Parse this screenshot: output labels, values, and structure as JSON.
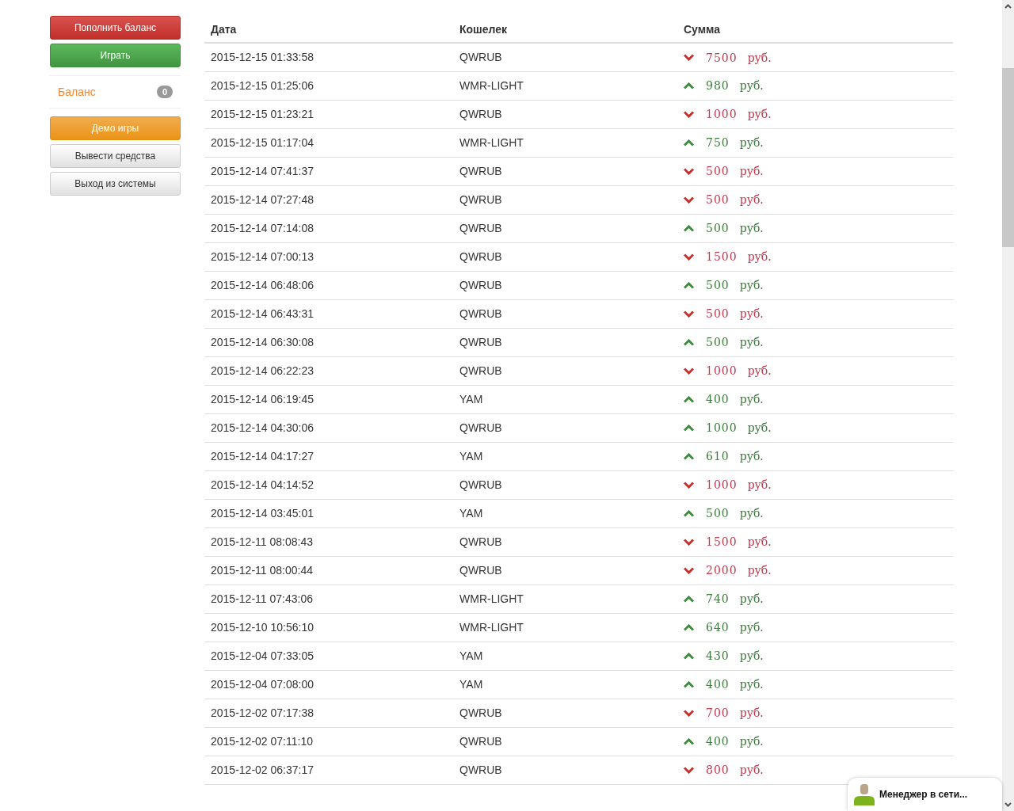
{
  "sidebar": {
    "top_buttons": [
      {
        "label": "Пополнить баланс",
        "kind": "danger"
      },
      {
        "label": "Играть",
        "kind": "success"
      }
    ],
    "balance": {
      "label": "Баланс",
      "badge": "0"
    },
    "bottom_buttons": [
      {
        "label": "Демо игры",
        "kind": "warning"
      },
      {
        "label": "Вывести средства",
        "kind": "default"
      },
      {
        "label": "Выход из системы",
        "kind": "default"
      }
    ]
  },
  "table": {
    "columns": [
      "Дата",
      "Кошелек",
      "Сумма"
    ],
    "rows": [
      {
        "date": "2015-12-15 01:33:58",
        "wallet": "QWRUB",
        "kind": "out",
        "amount": "7500",
        "currency": "руб."
      },
      {
        "date": "2015-12-15 01:25:06",
        "wallet": "WMR-LIGHT",
        "kind": "in",
        "amount": "980",
        "currency": "руб."
      },
      {
        "date": "2015-12-15 01:23:21",
        "wallet": "QWRUB",
        "kind": "out",
        "amount": "1000",
        "currency": "руб."
      },
      {
        "date": "2015-12-15 01:17:04",
        "wallet": "WMR-LIGHT",
        "kind": "in",
        "amount": "750",
        "currency": "руб."
      },
      {
        "date": "2015-12-14 07:41:37",
        "wallet": "QWRUB",
        "kind": "out",
        "amount": "500",
        "currency": "руб."
      },
      {
        "date": "2015-12-14 07:27:48",
        "wallet": "QWRUB",
        "kind": "out",
        "amount": "500",
        "currency": "руб."
      },
      {
        "date": "2015-12-14 07:14:08",
        "wallet": "QWRUB",
        "kind": "in",
        "amount": "500",
        "currency": "руб."
      },
      {
        "date": "2015-12-14 07:00:13",
        "wallet": "QWRUB",
        "kind": "out",
        "amount": "1500",
        "currency": "руб."
      },
      {
        "date": "2015-12-14 06:48:06",
        "wallet": "QWRUB",
        "kind": "in",
        "amount": "500",
        "currency": "руб."
      },
      {
        "date": "2015-12-14 06:43:31",
        "wallet": "QWRUB",
        "kind": "out",
        "amount": "500",
        "currency": "руб."
      },
      {
        "date": "2015-12-14 06:30:08",
        "wallet": "QWRUB",
        "kind": "in",
        "amount": "500",
        "currency": "руб."
      },
      {
        "date": "2015-12-14 06:22:23",
        "wallet": "QWRUB",
        "kind": "out",
        "amount": "1000",
        "currency": "руб."
      },
      {
        "date": "2015-12-14 06:19:45",
        "wallet": "YAM",
        "kind": "in",
        "amount": "400",
        "currency": "руб."
      },
      {
        "date": "2015-12-14 04:30:06",
        "wallet": "QWRUB",
        "kind": "in",
        "amount": "1000",
        "currency": "руб."
      },
      {
        "date": "2015-12-14 04:17:27",
        "wallet": "YAM",
        "kind": "in",
        "amount": "610",
        "currency": "руб."
      },
      {
        "date": "2015-12-14 04:14:52",
        "wallet": "QWRUB",
        "kind": "out",
        "amount": "1000",
        "currency": "руб."
      },
      {
        "date": "2015-12-14 03:45:01",
        "wallet": "YAM",
        "kind": "in",
        "amount": "500",
        "currency": "руб."
      },
      {
        "date": "2015-12-11 08:08:43",
        "wallet": "QWRUB",
        "kind": "out",
        "amount": "1500",
        "currency": "руб."
      },
      {
        "date": "2015-12-11 08:00:44",
        "wallet": "QWRUB",
        "kind": "out",
        "amount": "2000",
        "currency": "руб."
      },
      {
        "date": "2015-12-11 07:43:06",
        "wallet": "WMR-LIGHT",
        "kind": "in",
        "amount": "740",
        "currency": "руб."
      },
      {
        "date": "2015-12-10 10:56:10",
        "wallet": "WMR-LIGHT",
        "kind": "in",
        "amount": "640",
        "currency": "руб."
      },
      {
        "date": "2015-12-04 07:33:05",
        "wallet": "YAM",
        "kind": "in",
        "amount": "430",
        "currency": "руб."
      },
      {
        "date": "2015-12-04 07:08:00",
        "wallet": "YAM",
        "kind": "in",
        "amount": "400",
        "currency": "руб."
      },
      {
        "date": "2015-12-02 07:17:38",
        "wallet": "QWRUB",
        "kind": "out",
        "amount": "700",
        "currency": "руб."
      },
      {
        "date": "2015-12-02 07:11:10",
        "wallet": "QWRUB",
        "kind": "in",
        "amount": "400",
        "currency": "руб."
      },
      {
        "date": "2015-12-02 06:37:17",
        "wallet": "QWRUB",
        "kind": "out",
        "amount": "800",
        "currency": "руб."
      }
    ]
  },
  "chat_widget": {
    "label": "Менеджер в сети..."
  }
}
